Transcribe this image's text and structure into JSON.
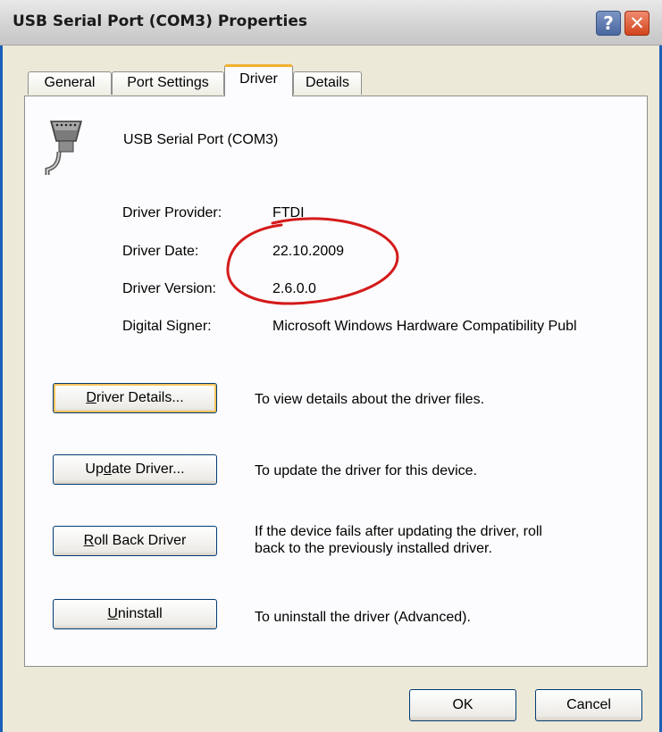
{
  "window": {
    "title": "USB Serial Port (COM3) Properties",
    "help_label": "?",
    "close_label": "✕"
  },
  "tabs": [
    {
      "label": "General",
      "active": false
    },
    {
      "label": "Port Settings",
      "active": false
    },
    {
      "label": "Driver",
      "active": true
    },
    {
      "label": "Details",
      "active": false
    }
  ],
  "device": {
    "icon": "serial-port-icon",
    "name": "USB Serial Port (COM3)"
  },
  "driver_info": [
    {
      "label": "Driver Provider:",
      "value": "FTDI"
    },
    {
      "label": "Driver Date:",
      "value": "22.10.2009"
    },
    {
      "label": "Driver Version:",
      "value": "2.6.0.0"
    },
    {
      "label": "Digital Signer:",
      "value": "Microsoft Windows Hardware Compatibility Publ"
    }
  ],
  "actions": [
    {
      "mnemonic": "D",
      "rest": "river Details...",
      "description": [
        "To view details about the driver files."
      ]
    },
    {
      "pre": "Up",
      "mnemonic": "d",
      "rest": "ate Driver...",
      "description": [
        "To update the driver for this device."
      ]
    },
    {
      "mnemonic": "R",
      "rest": "oll Back Driver",
      "description": [
        "If the device fails after updating the driver, roll",
        "back to the previously installed driver."
      ]
    },
    {
      "mnemonic": "U",
      "rest": "ninstall",
      "description": [
        "To uninstall the driver (Advanced)."
      ]
    }
  ],
  "footer": {
    "ok_label": "OK",
    "cancel_label": "Cancel"
  },
  "colors": {
    "annotation_circle": "#d41a1a",
    "window_border": "#1b5fb9",
    "active_tab_accent": "#f0b030"
  }
}
